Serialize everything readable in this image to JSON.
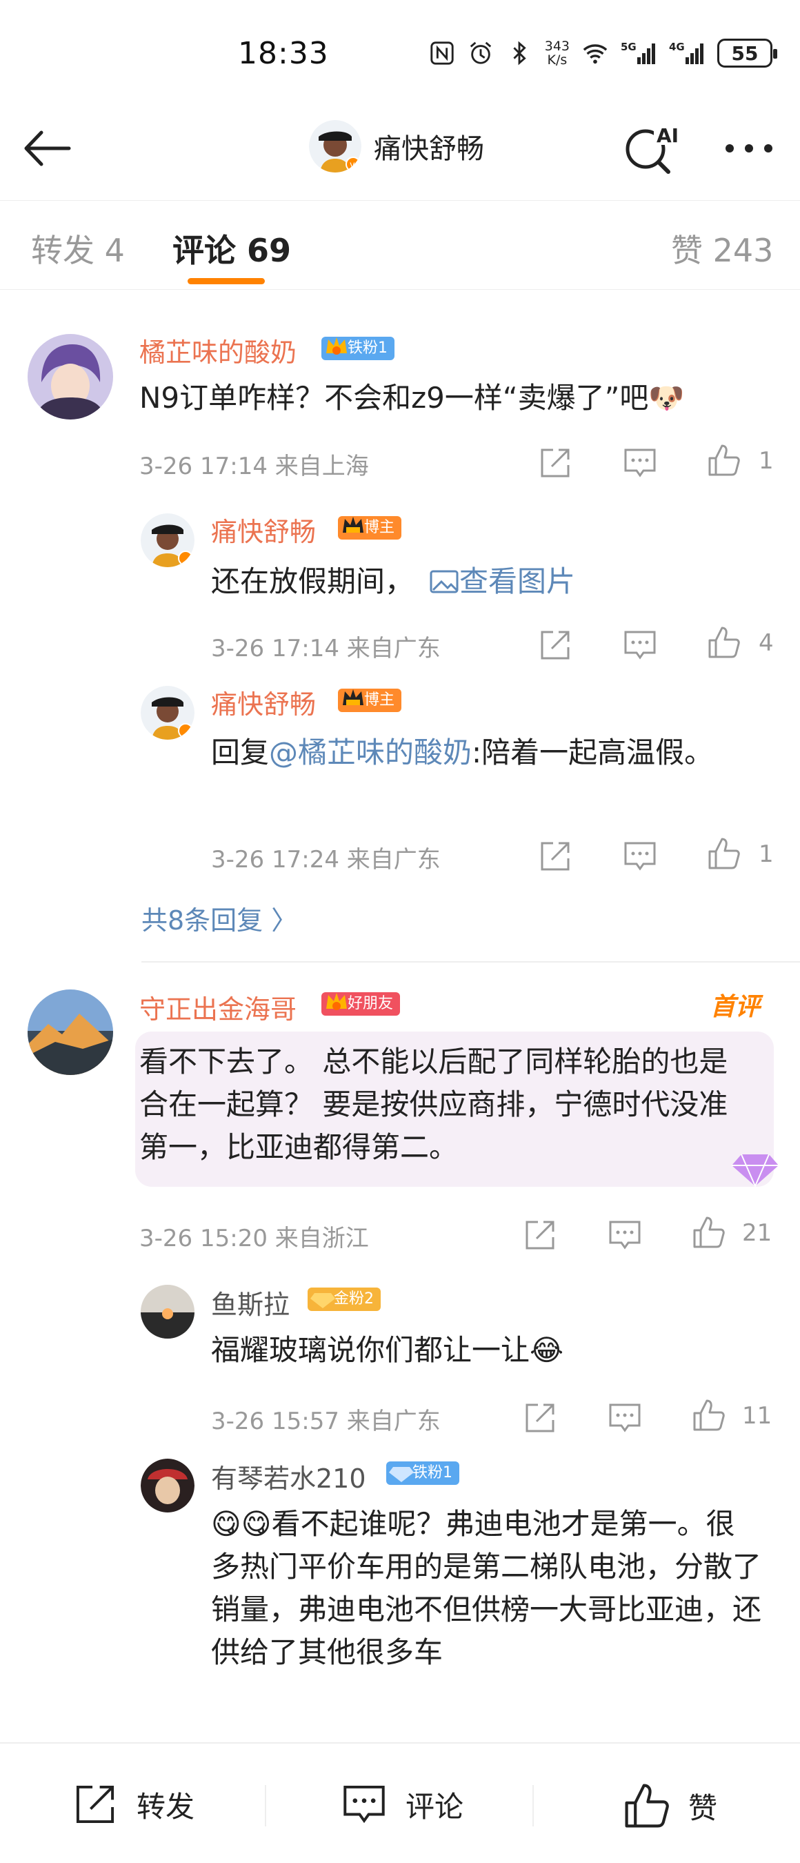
{
  "status": {
    "time": "18:33",
    "net_speed_top": "343",
    "net_speed_bottom": "K/s",
    "battery": "55",
    "signal1": "5G",
    "signal2": "4G"
  },
  "header": {
    "title": "痛快舒畅"
  },
  "tabs": {
    "repost": "转发 4",
    "comment": "评论 69",
    "like": "赞 243"
  },
  "comments": [
    {
      "user": "橘芷味的酸奶",
      "badge": "铁粉1",
      "text": "N9订单咋样？不会和z9一样“卖爆了”吧🐶",
      "time": "3-26 17:14 来自上海",
      "likes": "1"
    },
    {
      "user": "痛快舒畅",
      "badge": "博主",
      "text": "还在放假期间，",
      "link": "查看图片",
      "time": "3-26 17:14 来自广东",
      "likes": "4"
    },
    {
      "user": "痛快舒畅",
      "badge": "博主",
      "text_prefix": "回复",
      "mention": "@橘芷味的酸奶",
      "text": ":陪着一起高温假。",
      "time": "3-26 17:24 来自广东",
      "likes": "1"
    },
    {
      "user": "守正出金海哥",
      "badge": "好朋友",
      "hot": "首评",
      "text": "看不下去了。 总不能以后配了同样轮胎的也是合在一起算？ 要是按供应商排，宁德时代没准第一，比亚迪都得第二。",
      "time": "3-26 15:20 来自浙江",
      "likes": "21"
    },
    {
      "user": "鱼斯拉",
      "badge": "金粉2",
      "text": "福耀玻璃说你们都让一让😂",
      "time": "3-26 15:57 来自广东",
      "likes": "11"
    },
    {
      "user": "有琴若水210",
      "badge": "铁粉1",
      "text": "😋😋看不起谁呢？弗迪电池才是第一。很多热门平价车用的是第二梯队电池，分散了销量，弗迪电池不但供榜一大哥比亚迪，还供给了其他很多车"
    }
  ],
  "more_replies": "共8条回复 〉",
  "bottom": {
    "repost": "转发",
    "comment": "评论",
    "like": "赞"
  },
  "colors": {
    "accent": "#ff8200",
    "username": "#eb7350",
    "link": "#5d88b8",
    "meta": "#999999"
  }
}
